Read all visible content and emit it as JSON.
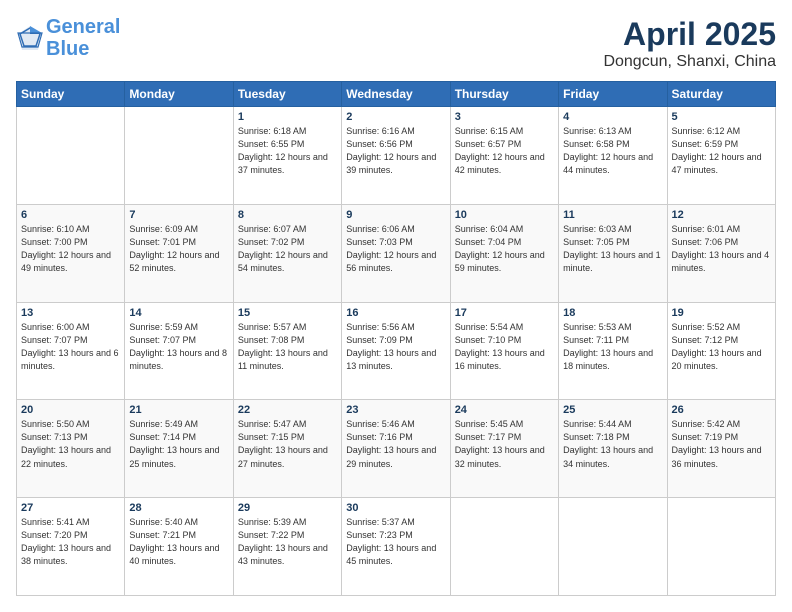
{
  "logo": {
    "line1": "General",
    "line2": "Blue"
  },
  "title": "April 2025",
  "subtitle": "Dongcun, Shanxi, China",
  "days_header": [
    "Sunday",
    "Monday",
    "Tuesday",
    "Wednesday",
    "Thursday",
    "Friday",
    "Saturday"
  ],
  "weeks": [
    [
      {
        "day": "",
        "info": ""
      },
      {
        "day": "",
        "info": ""
      },
      {
        "day": "1",
        "info": "Sunrise: 6:18 AM\nSunset: 6:55 PM\nDaylight: 12 hours and 37 minutes."
      },
      {
        "day": "2",
        "info": "Sunrise: 6:16 AM\nSunset: 6:56 PM\nDaylight: 12 hours and 39 minutes."
      },
      {
        "day": "3",
        "info": "Sunrise: 6:15 AM\nSunset: 6:57 PM\nDaylight: 12 hours and 42 minutes."
      },
      {
        "day": "4",
        "info": "Sunrise: 6:13 AM\nSunset: 6:58 PM\nDaylight: 12 hours and 44 minutes."
      },
      {
        "day": "5",
        "info": "Sunrise: 6:12 AM\nSunset: 6:59 PM\nDaylight: 12 hours and 47 minutes."
      }
    ],
    [
      {
        "day": "6",
        "info": "Sunrise: 6:10 AM\nSunset: 7:00 PM\nDaylight: 12 hours and 49 minutes."
      },
      {
        "day": "7",
        "info": "Sunrise: 6:09 AM\nSunset: 7:01 PM\nDaylight: 12 hours and 52 minutes."
      },
      {
        "day": "8",
        "info": "Sunrise: 6:07 AM\nSunset: 7:02 PM\nDaylight: 12 hours and 54 minutes."
      },
      {
        "day": "9",
        "info": "Sunrise: 6:06 AM\nSunset: 7:03 PM\nDaylight: 12 hours and 56 minutes."
      },
      {
        "day": "10",
        "info": "Sunrise: 6:04 AM\nSunset: 7:04 PM\nDaylight: 12 hours and 59 minutes."
      },
      {
        "day": "11",
        "info": "Sunrise: 6:03 AM\nSunset: 7:05 PM\nDaylight: 13 hours and 1 minute."
      },
      {
        "day": "12",
        "info": "Sunrise: 6:01 AM\nSunset: 7:06 PM\nDaylight: 13 hours and 4 minutes."
      }
    ],
    [
      {
        "day": "13",
        "info": "Sunrise: 6:00 AM\nSunset: 7:07 PM\nDaylight: 13 hours and 6 minutes."
      },
      {
        "day": "14",
        "info": "Sunrise: 5:59 AM\nSunset: 7:07 PM\nDaylight: 13 hours and 8 minutes."
      },
      {
        "day": "15",
        "info": "Sunrise: 5:57 AM\nSunset: 7:08 PM\nDaylight: 13 hours and 11 minutes."
      },
      {
        "day": "16",
        "info": "Sunrise: 5:56 AM\nSunset: 7:09 PM\nDaylight: 13 hours and 13 minutes."
      },
      {
        "day": "17",
        "info": "Sunrise: 5:54 AM\nSunset: 7:10 PM\nDaylight: 13 hours and 16 minutes."
      },
      {
        "day": "18",
        "info": "Sunrise: 5:53 AM\nSunset: 7:11 PM\nDaylight: 13 hours and 18 minutes."
      },
      {
        "day": "19",
        "info": "Sunrise: 5:52 AM\nSunset: 7:12 PM\nDaylight: 13 hours and 20 minutes."
      }
    ],
    [
      {
        "day": "20",
        "info": "Sunrise: 5:50 AM\nSunset: 7:13 PM\nDaylight: 13 hours and 22 minutes."
      },
      {
        "day": "21",
        "info": "Sunrise: 5:49 AM\nSunset: 7:14 PM\nDaylight: 13 hours and 25 minutes."
      },
      {
        "day": "22",
        "info": "Sunrise: 5:47 AM\nSunset: 7:15 PM\nDaylight: 13 hours and 27 minutes."
      },
      {
        "day": "23",
        "info": "Sunrise: 5:46 AM\nSunset: 7:16 PM\nDaylight: 13 hours and 29 minutes."
      },
      {
        "day": "24",
        "info": "Sunrise: 5:45 AM\nSunset: 7:17 PM\nDaylight: 13 hours and 32 minutes."
      },
      {
        "day": "25",
        "info": "Sunrise: 5:44 AM\nSunset: 7:18 PM\nDaylight: 13 hours and 34 minutes."
      },
      {
        "day": "26",
        "info": "Sunrise: 5:42 AM\nSunset: 7:19 PM\nDaylight: 13 hours and 36 minutes."
      }
    ],
    [
      {
        "day": "27",
        "info": "Sunrise: 5:41 AM\nSunset: 7:20 PM\nDaylight: 13 hours and 38 minutes."
      },
      {
        "day": "28",
        "info": "Sunrise: 5:40 AM\nSunset: 7:21 PM\nDaylight: 13 hours and 40 minutes."
      },
      {
        "day": "29",
        "info": "Sunrise: 5:39 AM\nSunset: 7:22 PM\nDaylight: 13 hours and 43 minutes."
      },
      {
        "day": "30",
        "info": "Sunrise: 5:37 AM\nSunset: 7:23 PM\nDaylight: 13 hours and 45 minutes."
      },
      {
        "day": "",
        "info": ""
      },
      {
        "day": "",
        "info": ""
      },
      {
        "day": "",
        "info": ""
      }
    ]
  ]
}
